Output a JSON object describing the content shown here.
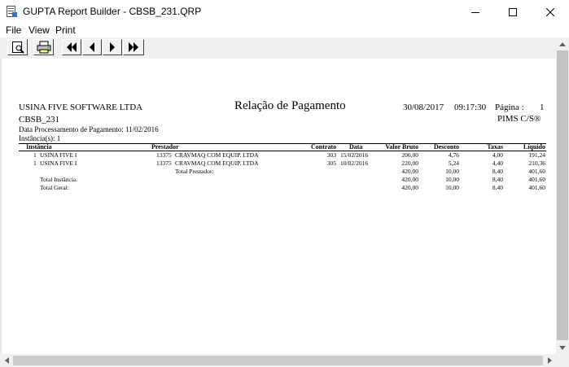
{
  "window": {
    "title": "GUPTA Report Builder - CBSB_231.QRP",
    "minimize_glyph": "—",
    "maximize_glyph": "☐",
    "close_glyph": "✕"
  },
  "menu": [
    "File",
    "View",
    "Print"
  ],
  "toolbar": {
    "buttons": [
      {
        "name": "preview-button",
        "icon": "page-magnifier-icon"
      },
      {
        "name": "print-button",
        "icon": "printer-icon"
      },
      {
        "name": "first-page-button",
        "icon": "double-left-arrow-icon"
      },
      {
        "name": "previous-page-button",
        "icon": "left-arrow-icon"
      },
      {
        "name": "next-page-button",
        "icon": "right-arrow-icon"
      },
      {
        "name": "last-page-button",
        "icon": "double-right-arrow-icon"
      }
    ]
  },
  "report": {
    "company": "USINA FIVE SOFTWARE LTDA",
    "title": "Relação de Pagamento",
    "date": "30/08/2017",
    "time": "09:17:30",
    "page_label": "Página :",
    "page_number": "1",
    "report_code": "CBSB_231",
    "system": "PIMS C/S®",
    "processing_date": "Data Processamento de Pagamento: 11/02/2016",
    "instances": "Instância(s): 1",
    "columns": {
      "instancia": "Instância",
      "prestador": "Prestador",
      "contrato": "Contrato",
      "data": "Data",
      "valor_bruto": "Valor Bruto",
      "desconto": "Desconto",
      "taxas": "Taxas",
      "liquido": "Líquido"
    },
    "rows": [
      {
        "inst_num": "1",
        "inst_name": "USINA FIVE I",
        "prest_code": "13375",
        "prest_name": "CRAVMAQ COM EQUIP. LTDA",
        "contrato": "303",
        "data": "15/02/2016",
        "valor_bruto": "200,00",
        "desconto": "4,76",
        "taxas": "4,00",
        "liquido": "191,24"
      },
      {
        "inst_num": "1",
        "inst_name": "USINA FIVE I",
        "prest_code": "13375",
        "prest_name": "CRAVMAQ COM EQUIP. LTDA",
        "contrato": "305",
        "data": "10/02/2016",
        "valor_bruto": "220,00",
        "desconto": "5,24",
        "taxas": "4,40",
        "liquido": "210,36"
      }
    ],
    "totals": [
      {
        "label": "Total Prestador:",
        "valor_bruto": "420,00",
        "desconto": "10,00",
        "taxas": "8,40",
        "liquido": "401,60"
      },
      {
        "label": "Total Instância:",
        "valor_bruto": "420,00",
        "desconto": "10,00",
        "taxas": "8,40",
        "liquido": "401,60"
      },
      {
        "label": "Total Geral:",
        "valor_bruto": "420,00",
        "desconto": "10,00",
        "taxas": "8,40",
        "liquido": "401,60"
      }
    ]
  }
}
